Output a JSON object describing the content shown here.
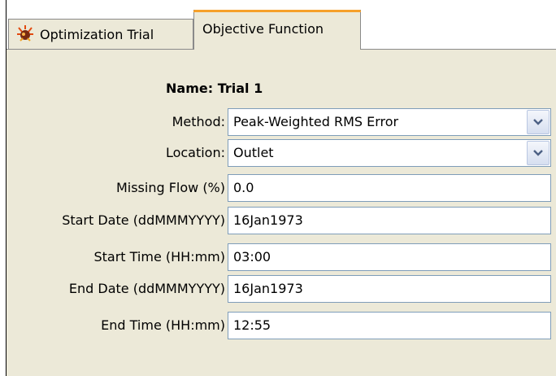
{
  "tabs": [
    {
      "label": "Optimization Trial",
      "icon": "optimization-trial-icon",
      "active": false
    },
    {
      "label": "Objective Function",
      "active": true
    }
  ],
  "form": {
    "name_label": "Name:",
    "name_value": "Trial 1",
    "method": {
      "label": "Method:",
      "value": "Peak-Weighted RMS Error"
    },
    "location": {
      "label": "Location:",
      "value": "Outlet"
    },
    "missing_flow": {
      "label": "Missing Flow (%)",
      "value": "0.0"
    },
    "start_date": {
      "label": "Start Date (ddMMMYYYY)",
      "value": "16Jan1973"
    },
    "start_time": {
      "label": "Start Time (HH:mm)",
      "value": "03:00"
    },
    "end_date": {
      "label": "End Date (ddMMMYYYY)",
      "value": "16Jan1973"
    },
    "end_time": {
      "label": "End Time (HH:mm)",
      "value": "12:55"
    }
  },
  "colors": {
    "panel_bg": "#ece9d8",
    "active_tab_accent": "#f6a02a",
    "field_border": "#7f9db9"
  }
}
